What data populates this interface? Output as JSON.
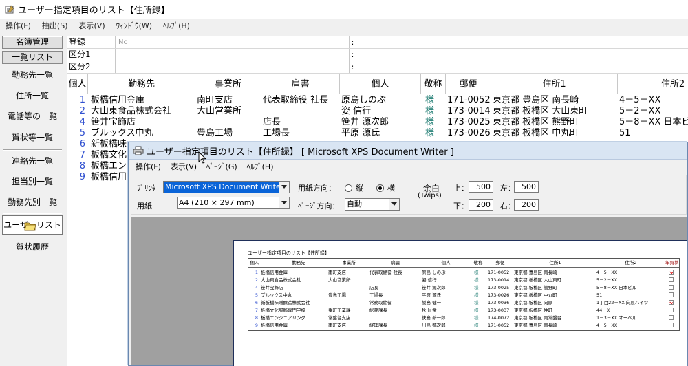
{
  "app": {
    "title": "ユーザー指定項目のリスト【住所録】",
    "menu": [
      "操作(F)",
      "抽出(S)",
      "表示(V)",
      "ｳｨﾝﾄﾞｳ(W)",
      "ﾍﾙﾌﾟ(H)"
    ]
  },
  "sidebar": {
    "tabs": [
      "名簿管理",
      "一覧リスト"
    ],
    "items": [
      "勤務先一覧",
      "住所一覧",
      "電話等の一覧",
      "賀状等一覧",
      "連絡先一覧",
      "担当別一覧",
      "勤務先別一覧",
      "ユーザーリスト",
      "賀状履歴"
    ],
    "active_index": 7
  },
  "filter": {
    "rows": [
      {
        "label": "登録",
        "value": "No",
        "sep": ":"
      },
      {
        "label": "区分1",
        "value": "",
        "sep": ":"
      },
      {
        "label": "区分2",
        "value": "",
        "sep": ":"
      }
    ]
  },
  "table": {
    "headers": [
      "個人",
      "勤務先",
      "事業所",
      "肩書",
      "個人",
      "敬称",
      "郵便",
      "住所1",
      "住所2"
    ],
    "rows": [
      {
        "no": "1",
        "company": "板橋信用金庫",
        "office": "南町支店",
        "title": "代表取締役 社長",
        "name": "原島しのぶ",
        "hon": "様",
        "zip": "171-0052",
        "addr1": "東京都 豊島区 南長崎",
        "addr2": "4－5－XX"
      },
      {
        "no": "2",
        "company": "大山東食品株式会社",
        "office": "大山営業所",
        "title": "",
        "name": "姿 信行",
        "hon": "様",
        "zip": "173-0014",
        "addr1": "東京都 板橋区 大山東町",
        "addr2": "5－2－XX"
      },
      {
        "no": "4",
        "company": "笹井宝飾店",
        "office": "",
        "title": "店長",
        "name": "笹井 源次郎",
        "hon": "様",
        "zip": "173-0025",
        "addr1": "東京都 板橋区 熊野町",
        "addr2": "5－8－XX 日本ビ"
      },
      {
        "no": "5",
        "company": "ブルックス中丸",
        "office": "豊島工場",
        "title": "工場長",
        "name": "平原 源氏",
        "hon": "様",
        "zip": "173-0026",
        "addr1": "東京都 板橋区 中丸町",
        "addr2": "51"
      },
      {
        "no": "6",
        "company": "新板橋味",
        "office": "",
        "title": "",
        "name": "",
        "hon": "",
        "zip": "",
        "addr1": "",
        "addr2": ""
      },
      {
        "no": "7",
        "company": "板橋文化",
        "office": "",
        "title": "",
        "name": "",
        "hon": "",
        "zip": "",
        "addr1": "",
        "addr2": ""
      },
      {
        "no": "8",
        "company": "板橋エン",
        "office": "",
        "title": "",
        "name": "",
        "hon": "",
        "zip": "",
        "addr1": "",
        "addr2": ""
      },
      {
        "no": "9",
        "company": "板橋信用",
        "office": "",
        "title": "",
        "name": "",
        "hon": "",
        "zip": "",
        "addr1": "",
        "addr2": ""
      }
    ]
  },
  "print_window": {
    "title": "ユーザー指定項目のリスト【住所録】 [ Microsoft XPS Document Writer ]",
    "menu": [
      "操作(F)",
      "表示(V)",
      "ﾍﾟｰｼﾞ(G)",
      "ﾍﾙﾌﾟ(H)"
    ],
    "printer_label": "ﾌﾟﾘﾝﾀ",
    "printer_value": "Microsoft XPS Document Writer",
    "paper_label": "用紙",
    "paper_value": "A4 (210 × 297 mm)",
    "orientation_label": "用紙方向：",
    "orientation_portrait": "縦",
    "orientation_landscape": "横",
    "orientation_selected": "横",
    "page_dir_label": "ﾍﾟｰｼﾞ方向：",
    "page_dir_value": "自動",
    "margin_label": "余白",
    "margin_unit": "(Twips)",
    "margin_top_label": "上：",
    "margin_top": "500",
    "margin_left_label": "左：",
    "margin_left": "500",
    "margin_bottom_label": "下：",
    "margin_bottom": "200",
    "margin_right_label": "右：",
    "margin_right": "200"
  },
  "preview": {
    "title": "ユーザー指定項目のリスト【住所録】",
    "headers": [
      "個人",
      "勤務先",
      "事業所",
      "肩書",
      "個人",
      "敬称",
      "郵便",
      "住所1",
      "住所2",
      "年賀状"
    ],
    "rows": [
      {
        "no": "1",
        "company": "板橋信用金庫",
        "office": "南町支店",
        "title": "代表取締役 社長",
        "name": "原島 しのぶ",
        "hon": "様",
        "zip": "171-0052",
        "addr1": "東京都 豊島区 南長崎",
        "addr2": "4－5－XX",
        "check": true
      },
      {
        "no": "2",
        "company": "大山東食品株式会社",
        "office": "大山営業所",
        "title": "",
        "name": "姿 信行",
        "hon": "様",
        "zip": "173-0014",
        "addr1": "東京都 板橋区 大山東町",
        "addr2": "5－2－XX",
        "check": false
      },
      {
        "no": "4",
        "company": "笹井宝飾店",
        "office": "",
        "title": "店長",
        "name": "笹井 源次郎",
        "hon": "様",
        "zip": "173-0025",
        "addr1": "東京都 板橋区 熊野町",
        "addr2": "5－8－XX 日本ビル",
        "check": false
      },
      {
        "no": "5",
        "company": "ブルックス中丸",
        "office": "豊島工場",
        "title": "工場長",
        "name": "平原 源氏",
        "hon": "様",
        "zip": "173-0026",
        "addr1": "東京都 板橋区 中丸町",
        "addr2": "51",
        "check": false
      },
      {
        "no": "6",
        "company": "新板橋味噌醸造株式会社",
        "office": "",
        "title": "常務取締役",
        "name": "飯島 健一",
        "hon": "様",
        "zip": "173-0036",
        "addr1": "東京都 板橋区 向原",
        "addr2": "1丁目22－XX 向原ハイツ",
        "check": true
      },
      {
        "no": "7",
        "company": "板橋文化服飾専門学校",
        "office": "乗町工業課",
        "title": "総務課長",
        "name": "秋山 金",
        "hon": "様",
        "zip": "173-0037",
        "addr1": "東京都 板橋区 仲町",
        "addr2": "44－X",
        "check": false
      },
      {
        "no": "8",
        "company": "板橋エンジニアリング",
        "office": "常盤台支店",
        "title": "",
        "name": "鉄島 新一郎",
        "hon": "様",
        "zip": "174-0072",
        "addr1": "東京都 板橋区 南常盤台",
        "addr2": "1－3－XX オーベル",
        "check": false
      },
      {
        "no": "9",
        "company": "板橋信用金庫",
        "office": "南町支店",
        "title": "経理課長",
        "name": "川島 都次郎",
        "hon": "様",
        "zip": "171-0052",
        "addr1": "東京都 豊島区 南長崎",
        "addr2": "4－5－XX",
        "check": false
      }
    ]
  }
}
